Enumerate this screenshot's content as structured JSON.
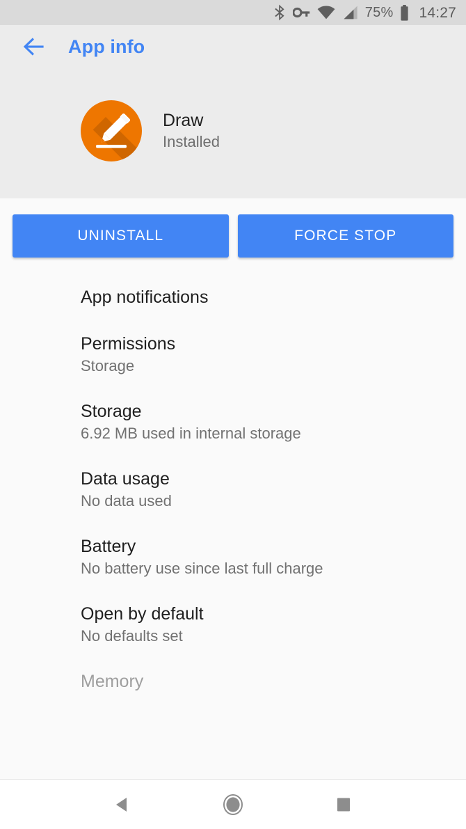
{
  "status_bar": {
    "icons": [
      "bluetooth-icon",
      "vpn-key-icon",
      "wifi-icon",
      "cell-signal-icon",
      "battery-icon"
    ],
    "battery_percent": "75%",
    "clock": "14:27"
  },
  "app_bar": {
    "back_icon": "back-arrow-icon",
    "title": "App info",
    "title_color": "#4285f4"
  },
  "app": {
    "icon": "draw-pencil-icon",
    "icon_color": "#ee7600",
    "name": "Draw",
    "status": "Installed"
  },
  "actions": [
    {
      "id": "uninstall",
      "label": "UNINSTALL"
    },
    {
      "id": "force-stop",
      "label": "FORCE STOP"
    }
  ],
  "settings_list": [
    {
      "id": "app-notifications",
      "title": "App notifications",
      "subtitle": ""
    },
    {
      "id": "permissions",
      "title": "Permissions",
      "subtitle": "Storage"
    },
    {
      "id": "storage",
      "title": "Storage",
      "subtitle": "6.92 MB used in internal storage"
    },
    {
      "id": "data-usage",
      "title": "Data usage",
      "subtitle": "No data used"
    },
    {
      "id": "battery",
      "title": "Battery",
      "subtitle": "No battery use since last full charge"
    },
    {
      "id": "open-by-default",
      "title": "Open by default",
      "subtitle": "No defaults set"
    },
    {
      "id": "memory",
      "title": "Memory",
      "subtitle": ""
    }
  ],
  "nav_bar": {
    "back": "nav-back-icon",
    "home": "nav-home-icon",
    "recents": "nav-recents-icon"
  },
  "colors": {
    "accent": "#4285f4",
    "status_bar_bg": "#dadada",
    "header_bg": "#ececec",
    "page_bg": "#fafafa",
    "nav_bg": "#ffffff"
  }
}
